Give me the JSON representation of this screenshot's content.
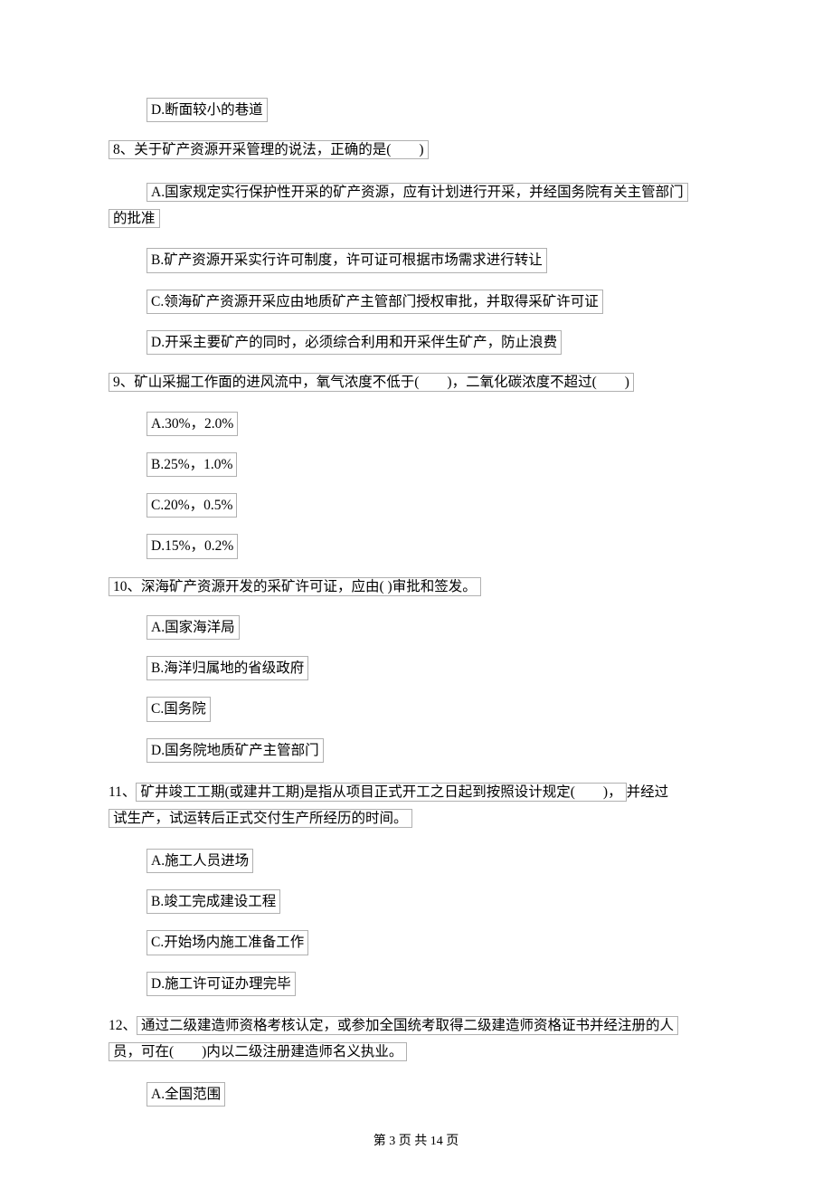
{
  "q7": {
    "optD": "D.断面较小的巷道"
  },
  "q8": {
    "stem": "8、关于矿产资源开采管理的说法，正确的是(　　)",
    "optA_line1": "A.国家规定实行保护性开采的矿产资源，应有计划进行开采，并经国务院有关主管部门",
    "optA_line2": "的批准",
    "optB": "B.矿产资源开采实行许可制度，许可证可根据市场需求进行转让",
    "optC": "C.领海矿产资源开采应由地质矿产主管部门授权审批，并取得采矿许可证",
    "optD": "D.开采主要矿产的同时，必须综合利用和开采伴生矿产，防止浪费"
  },
  "q9": {
    "stem": "9、矿山采掘工作面的进风流中，氧气浓度不低于(　　)，二氧化碳浓度不超过(　　)",
    "optA": "A.30%，2.0%",
    "optB": "B.25%，1.0%",
    "optC": "C.20%，0.5%",
    "optD": "D.15%，0.2%"
  },
  "q10": {
    "stem": "10、深海矿产资源开发的采矿许可证，应由(  )审批和签发。",
    "optA": "A.国家海洋局",
    "optB": "B.海洋归属地的省级政府",
    "optC": "C.国务院",
    "optD": "D.国务院地质矿产主管部门"
  },
  "q11": {
    "stem_line1_pre": "11、",
    "stem_line1": "矿井竣工工期(或建井工期)是指从项目正式开工之日起到按照设计规定(　　)，",
    "stem_line1_suffix": "并经过",
    "stem_line2": "试生产，试运转后正式交付生产所经历的时间。",
    "optA": "A.施工人员进场",
    "optB": "B.竣工完成建设工程",
    "optC": "C.开始场内施工准备工作",
    "optD": "D.施工许可证办理完毕"
  },
  "q12": {
    "stem_line1_pre": "12、",
    "stem_line1": "通过二级建造师资格考核认定，或参加全国统考取得二级建造师资格证书并经注册的人",
    "stem_line2": "员，可在(　　)内以二级注册建造师名义执业。",
    "optA": "A.全国范围"
  },
  "footer": "第 3 页 共 14 页"
}
